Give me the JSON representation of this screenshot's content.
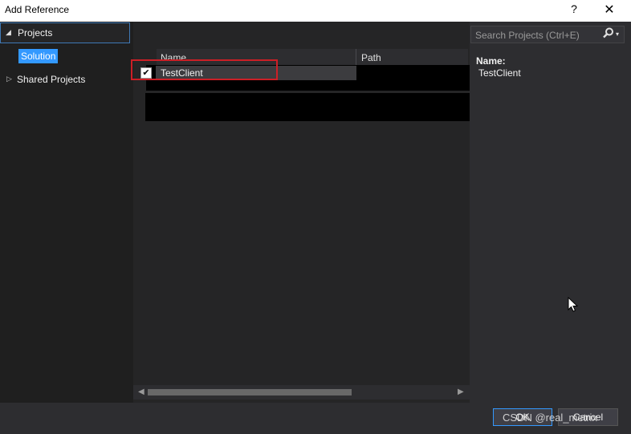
{
  "window": {
    "title": "Add Reference",
    "help_label": "?",
    "close_label": "✕"
  },
  "sidebar": {
    "projects": {
      "label": "Projects",
      "arrow": "◢"
    },
    "solution": {
      "label": "Solution"
    },
    "shared": {
      "label": "Shared Projects",
      "arrow": "▷"
    }
  },
  "grid": {
    "columns": [
      "Name",
      "Path"
    ],
    "rows": [
      {
        "checked": true,
        "check_glyph": "✔",
        "name": "TestClient"
      }
    ]
  },
  "search": {
    "placeholder": "Search Projects (Ctrl+E)",
    "icon": "search-icon",
    "dropdown": "▾"
  },
  "details": {
    "name_label": "Name:",
    "name_value": "TestClient"
  },
  "buttons": {
    "ok": "OK",
    "cancel": "Cancel"
  },
  "scroll": {
    "left": "◀",
    "right": "▶"
  },
  "watermark": "CSDN @real_metrix",
  "colors": {
    "accent": "#3399ff",
    "highlight": "#cc1f26",
    "background": "#2d2d30"
  }
}
